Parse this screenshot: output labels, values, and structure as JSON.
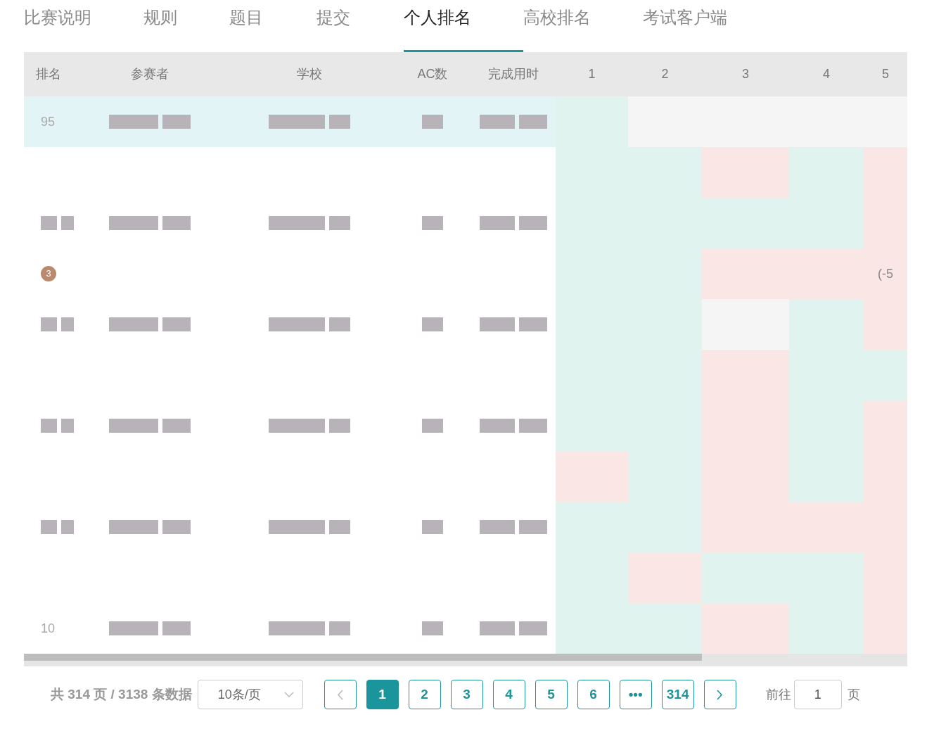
{
  "tabs": [
    {
      "label": "比赛说明",
      "selected": false
    },
    {
      "label": "规则",
      "selected": false
    },
    {
      "label": "题目",
      "selected": false
    },
    {
      "label": "提交",
      "selected": false
    },
    {
      "label": "个人排名",
      "selected": true
    },
    {
      "label": "高校排名",
      "selected": false
    },
    {
      "label": "考试客户端",
      "selected": false
    }
  ],
  "table": {
    "columns": [
      "排名",
      "参赛者",
      "学校",
      "AC数",
      "完成用时",
      "1",
      "2",
      "3",
      "4",
      "5"
    ],
    "rows": [
      {
        "rank": "95",
        "medal": "",
        "highlighted": true,
        "masked": true,
        "note": "",
        "problems": [
          {
            "kind": "ac"
          },
          {
            "kind": "none"
          },
          {
            "kind": "none"
          },
          {
            "kind": "none"
          },
          {
            "kind": "none"
          }
        ]
      },
      {
        "rank": "",
        "medal": "",
        "highlighted": false,
        "masked": false,
        "note": "",
        "problems": [
          {
            "kind": "ac"
          },
          {
            "kind": "ac"
          },
          {
            "kind": "wa"
          },
          {
            "kind": "ac"
          },
          {
            "kind": "wa"
          }
        ]
      },
      {
        "rank": "",
        "medal": "",
        "highlighted": false,
        "masked": true,
        "note": "",
        "problems": [
          {
            "kind": "ac"
          },
          {
            "kind": "ac"
          },
          {
            "kind": "ac"
          },
          {
            "kind": "ac"
          },
          {
            "kind": "wa"
          }
        ]
      },
      {
        "rank": "",
        "medal": "3",
        "highlighted": false,
        "masked": false,
        "note": "(-5",
        "problems": [
          {
            "kind": "ac"
          },
          {
            "kind": "ac"
          },
          {
            "kind": "wa"
          },
          {
            "kind": "wa"
          },
          {
            "kind": "wa"
          }
        ]
      },
      {
        "rank": "",
        "medal": "",
        "highlighted": false,
        "masked": true,
        "note": "",
        "problems": [
          {
            "kind": "ac"
          },
          {
            "kind": "ac"
          },
          {
            "kind": "none"
          },
          {
            "kind": "ac"
          },
          {
            "kind": "wa"
          }
        ]
      },
      {
        "rank": "",
        "medal": "",
        "highlighted": false,
        "masked": false,
        "note": "",
        "problems": [
          {
            "kind": "ac"
          },
          {
            "kind": "ac"
          },
          {
            "kind": "wa"
          },
          {
            "kind": "ac"
          },
          {
            "kind": "ac"
          }
        ]
      },
      {
        "rank": "",
        "medal": "",
        "highlighted": false,
        "masked": true,
        "note": "",
        "problems": [
          {
            "kind": "ac"
          },
          {
            "kind": "ac"
          },
          {
            "kind": "wa"
          },
          {
            "kind": "ac"
          },
          {
            "kind": "wa"
          }
        ]
      },
      {
        "rank": "",
        "medal": "",
        "highlighted": false,
        "masked": false,
        "note": "",
        "problems": [
          {
            "kind": "wa"
          },
          {
            "kind": "ac"
          },
          {
            "kind": "wa"
          },
          {
            "kind": "ac"
          },
          {
            "kind": "wa"
          }
        ]
      },
      {
        "rank": "",
        "medal": "",
        "highlighted": false,
        "masked": true,
        "note": "",
        "problems": [
          {
            "kind": "ac"
          },
          {
            "kind": "ac"
          },
          {
            "kind": "wa"
          },
          {
            "kind": "wa"
          },
          {
            "kind": "wa"
          }
        ]
      },
      {
        "rank": "",
        "medal": "",
        "highlighted": false,
        "masked": false,
        "note": "",
        "problems": [
          {
            "kind": "ac"
          },
          {
            "kind": "wa"
          },
          {
            "kind": "ac"
          },
          {
            "kind": "ac"
          },
          {
            "kind": "wa"
          }
        ]
      },
      {
        "rank": "10",
        "medal": "",
        "highlighted": false,
        "masked": true,
        "note": "",
        "problems": [
          {
            "kind": "ac"
          },
          {
            "kind": "ac"
          },
          {
            "kind": "wa"
          },
          {
            "kind": "ac"
          },
          {
            "kind": "wa"
          }
        ]
      }
    ]
  },
  "pagination": {
    "total": "共 314 页 / 3138 条数据",
    "page_size": "10条/页",
    "pages": [
      {
        "label": "1",
        "selected": true
      },
      {
        "label": "2",
        "selected": false
      },
      {
        "label": "3",
        "selected": false
      },
      {
        "label": "4",
        "selected": false
      },
      {
        "label": "5",
        "selected": false
      },
      {
        "label": "6",
        "selected": false
      },
      {
        "label": "•••",
        "selected": false
      },
      {
        "label": "314",
        "selected": false
      }
    ],
    "goto_label": "前往",
    "goto_value": "1",
    "goto_unit": "页"
  }
}
